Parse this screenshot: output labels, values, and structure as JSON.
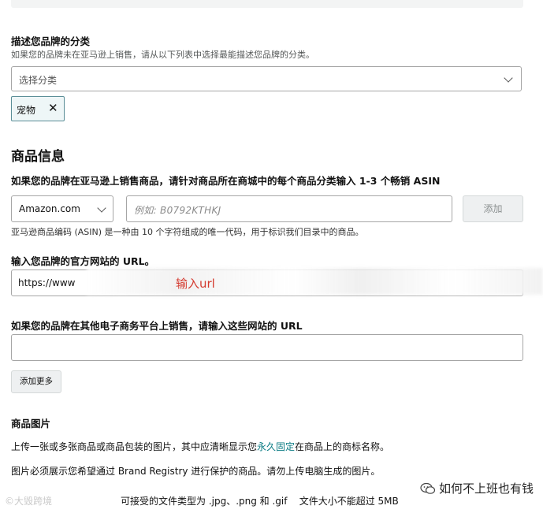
{
  "category": {
    "label": "描述您品牌的分类",
    "hint": "如果您的品牌未在亚马逊上销售，请从以下列表中选择最能描述您品牌的分类。",
    "select_placeholder": "选择分类",
    "chip_label": "宠物",
    "chip_remove": "✕"
  },
  "product_info": {
    "title": "商品信息",
    "asin_label": "如果您的品牌在亚马逊上销售商品，请针对商品所在商城中的每个商品分类输入 1-3 个畅销 ASIN",
    "store_value": "Amazon.com",
    "asin_placeholder": "例如:  B0792KTHKJ",
    "add_button": "添加",
    "asin_hint": "亚马逊商品编码 (ASIN) 是一种由 10 个字符组成的唯一代码，用于标识我们目录中的商品。",
    "website_label": "输入您品牌的官方网站的 URL。",
    "website_value": "https://www",
    "annotation": "输入url",
    "other_label": "如果您的品牌在其他电子商务平台上销售，请输入这些网站的 URL",
    "add_more_button": "添加更多"
  },
  "images": {
    "title": "商品图片",
    "line1_pre": "上传一张或多张商品或商品包装的图片，其中应清晰显示您",
    "line1_link": "永久固定",
    "line1_post": "在商品上的商标名称。",
    "line2": "图片必须展示您希望通过 Brand Registry 进行保护的商品。请勿上传电脑生成的图片。",
    "line3": "可接受的文件类型为 .jpg、.png 和 .gif    文件大小不能超过 5MB"
  },
  "watermark": {
    "text": "如何不上班也有钱",
    "left_text": "©大毁跨境"
  }
}
